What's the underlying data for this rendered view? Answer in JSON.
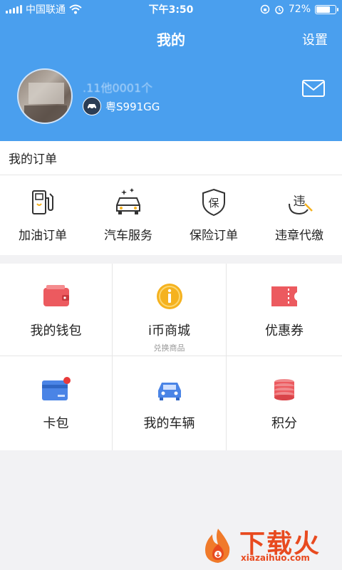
{
  "status_bar": {
    "carrier": "中国联通",
    "time": "下午3:50",
    "battery": "72%",
    "battery_level": 0.72
  },
  "header": {
    "title": "我的",
    "settings_label": "设置"
  },
  "profile": {
    "username": ".11他0001个",
    "plate": "粤S991GG"
  },
  "orders": {
    "title": "我的订单",
    "items": [
      {
        "label": "加油订单",
        "icon": "fuel-pump-icon"
      },
      {
        "label": "汽车服务",
        "icon": "car-wash-icon"
      },
      {
        "label": "保险订单",
        "icon": "insurance-shield-icon"
      },
      {
        "label": "违章代缴",
        "icon": "violation-icon"
      }
    ]
  },
  "grid": [
    {
      "label": "我的钱包",
      "sub": "",
      "icon": "wallet-icon",
      "color": "#ec5a5f"
    },
    {
      "label": "i币商城",
      "sub": "兑换商品",
      "icon": "coin-icon",
      "color": "#f5b21f"
    },
    {
      "label": "优惠券",
      "sub": "",
      "icon": "coupon-icon",
      "color": "#ec5a5f"
    },
    {
      "label": "卡包",
      "sub": "",
      "icon": "card-icon",
      "color": "#4a84e6"
    },
    {
      "label": "我的车辆",
      "sub": "",
      "icon": "car-icon",
      "color": "#4a84e6"
    },
    {
      "label": "积分",
      "sub": "",
      "icon": "points-coins-icon",
      "color": "#ec5a5f"
    }
  ],
  "watermark": {
    "text": "下载火",
    "url": "xiazaihuo.com"
  },
  "colors": {
    "primary": "#4a9fee",
    "red": "#ec5a5f",
    "yellow": "#f5b21f",
    "blue": "#4a84e6"
  }
}
